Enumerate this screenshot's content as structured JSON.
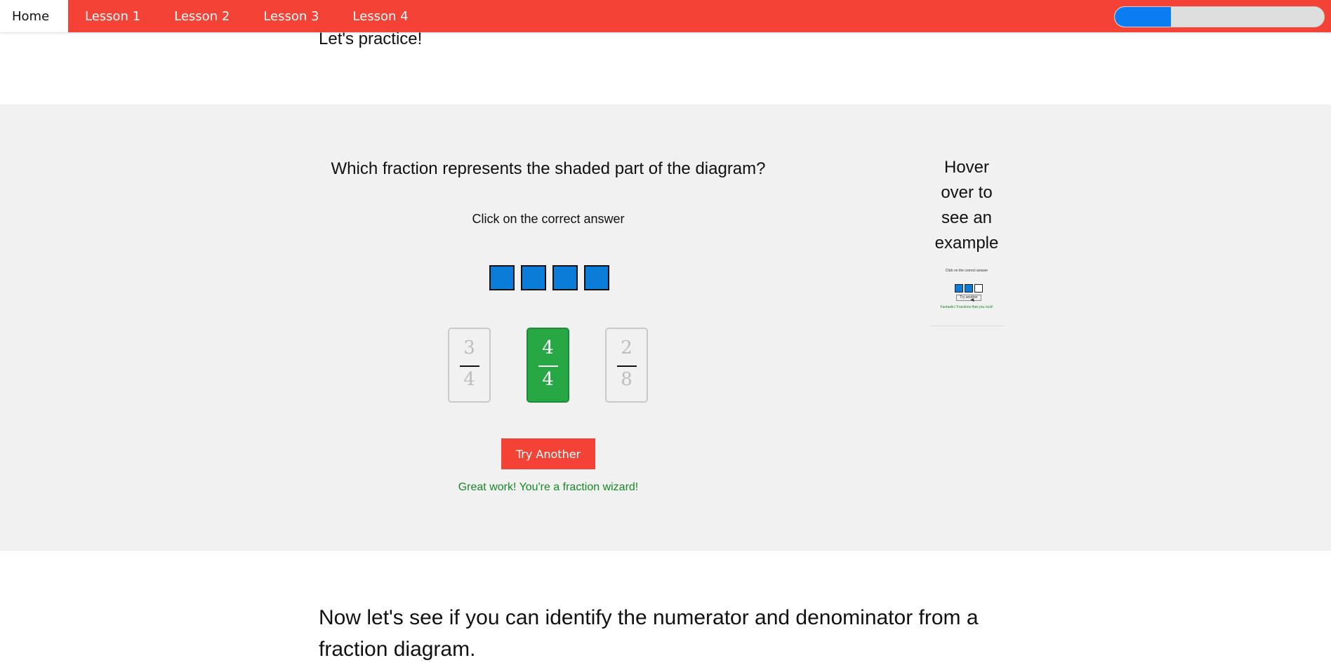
{
  "nav": {
    "items": [
      {
        "label": "Home",
        "active": true
      },
      {
        "label": "Lesson 1",
        "active": false
      },
      {
        "label": "Lesson 2",
        "active": false
      },
      {
        "label": "Lesson 3",
        "active": false
      },
      {
        "label": "Lesson 4",
        "active": false
      }
    ],
    "progress_fraction": 0.27,
    "colors": {
      "bar": "#f44336",
      "progress": "#0b7cf2"
    }
  },
  "intro": {
    "text": "Let's practice!"
  },
  "practice": {
    "question": "Which fraction represents the shaded part of the diagram?",
    "instruction": "Click on the correct answer",
    "diagram_cells": [
      "shaded",
      "shaded",
      "shaded",
      "shaded"
    ],
    "choices": [
      {
        "numerator": "3",
        "denominator": "4",
        "state": "default"
      },
      {
        "numerator": "4",
        "denominator": "4",
        "state": "correct"
      },
      {
        "numerator": "2",
        "denominator": "8",
        "state": "default"
      }
    ],
    "try_another_label": "Try Another",
    "feedback": "Great work! You're a fraction wizard!"
  },
  "example": {
    "title": "Hover over to see an example",
    "mini_instruction": "Click on the correct answer",
    "mini_cells": [
      "shaded",
      "shaded",
      "empty"
    ],
    "mini_button": "Try another",
    "mini_feedback": "Fantastic! Fractions that you rock!"
  },
  "next_section": {
    "heading": "Now let's see if you can identify the numerator and denominator from a fraction diagram."
  }
}
